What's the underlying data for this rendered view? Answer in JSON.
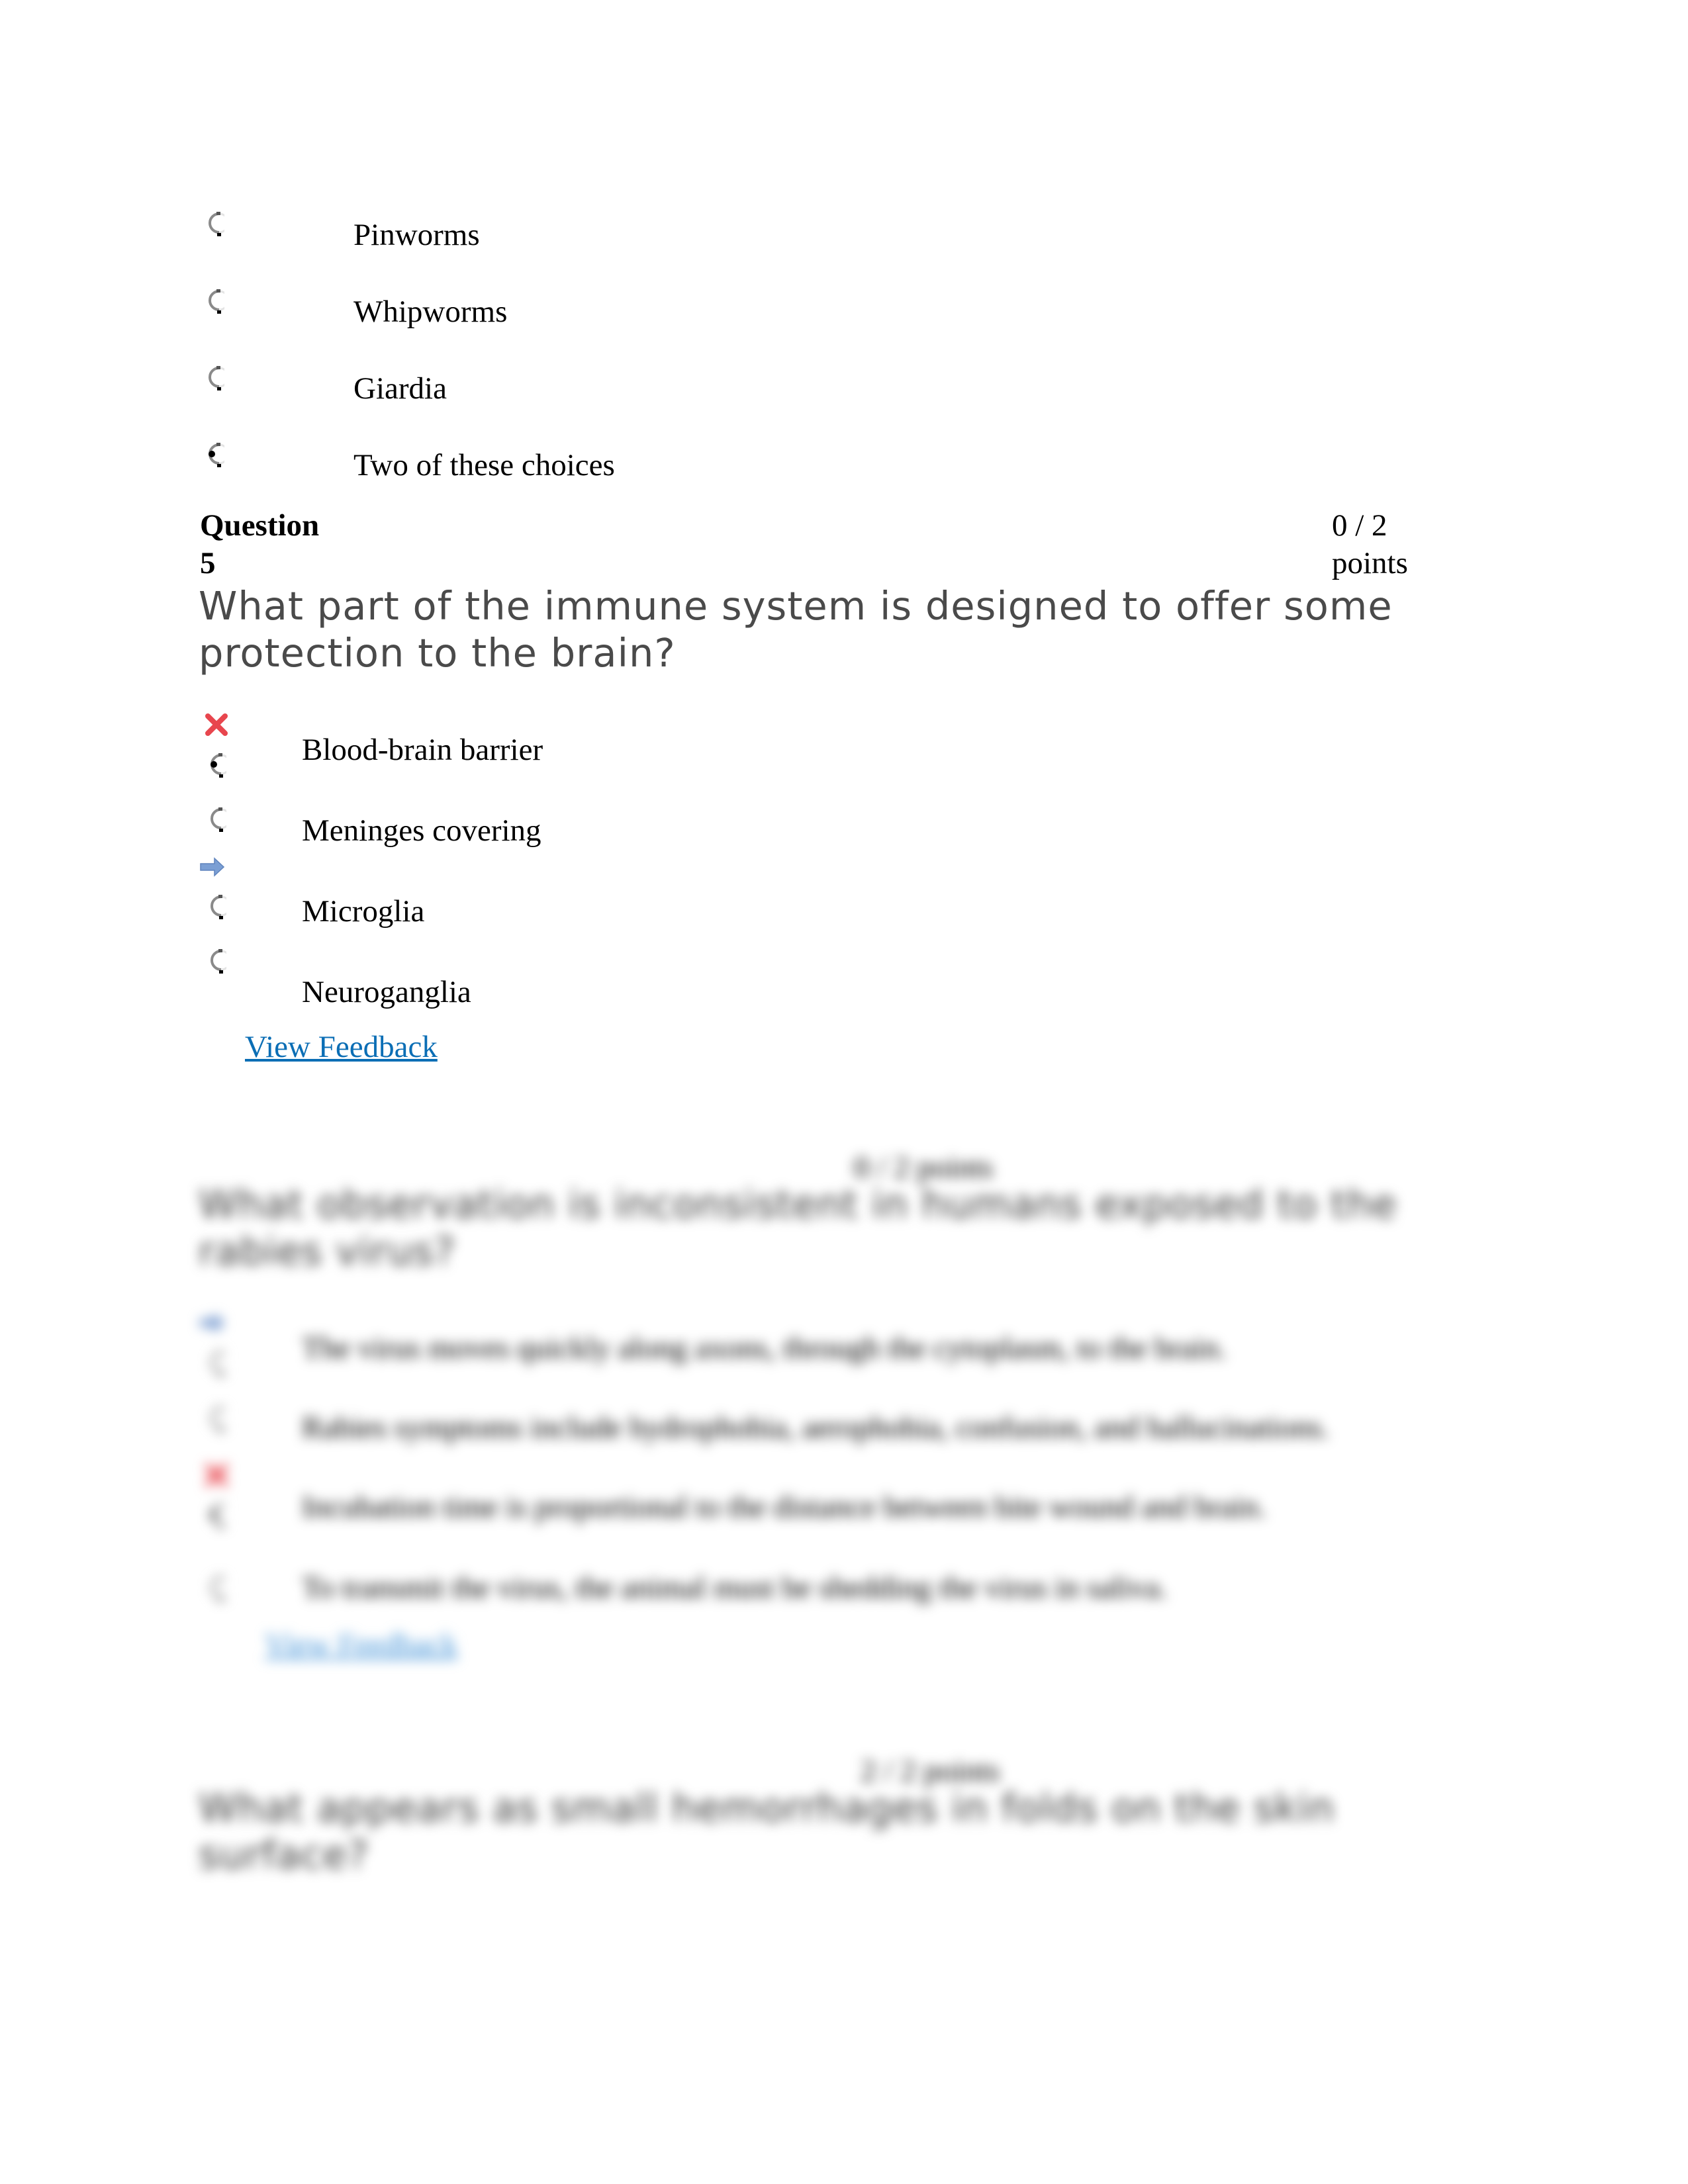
{
  "question4_tail": {
    "options": [
      {
        "label": "Pinworms",
        "selected": false
      },
      {
        "label": "Whipworms",
        "selected": false
      },
      {
        "label": "Giardia",
        "selected": false
      },
      {
        "label": "Two of these choices",
        "selected": true
      }
    ]
  },
  "question5": {
    "label_line1": "Question",
    "label_line2": "5",
    "points_line1": "0 / 2",
    "points_line2": "points",
    "text": "What part of the immune system is designed to offer some protection to the brain?",
    "options": [
      {
        "label": "Blood-brain barrier",
        "selected": true,
        "marker": "incorrect-x"
      },
      {
        "label": "Meninges covering",
        "selected": false,
        "marker": ""
      },
      {
        "label": "Microglia",
        "selected": false,
        "marker": "correct-arrow"
      },
      {
        "label": "Neuroganglia",
        "selected": false,
        "marker": ""
      }
    ],
    "feedback_link": "View Feedback"
  },
  "question6_blurred": {
    "points": "0 / 2 points",
    "text": "What observation is inconsistent in humans exposed to the rabies virus?",
    "options": [
      {
        "label": "The virus moves quickly along axons, through the cytoplasm, to the brain.",
        "selected": false,
        "marker": "correct-arrow"
      },
      {
        "label": "Rabies symptoms include hydrophobia, aerophobia, confusion, and hallucinations.",
        "selected": false,
        "marker": ""
      },
      {
        "label": "Incubation time is proportional to the distance between bite wound and brain.",
        "selected": true,
        "marker": "incorrect-x"
      },
      {
        "label": "To transmit the virus, the animal must be shedding the virus in saliva.",
        "selected": false,
        "marker": ""
      }
    ],
    "feedback_link": "View Feedback"
  },
  "question7_blurred": {
    "points": "2 / 2 points",
    "text": "What appears as small hemorrhages in folds on the skin surface?"
  },
  "colors": {
    "question_text": "#4a4a4a",
    "link": "#0b6eb5",
    "incorrect": "#e8464e",
    "correct_arrow": "#7b9fd4"
  }
}
